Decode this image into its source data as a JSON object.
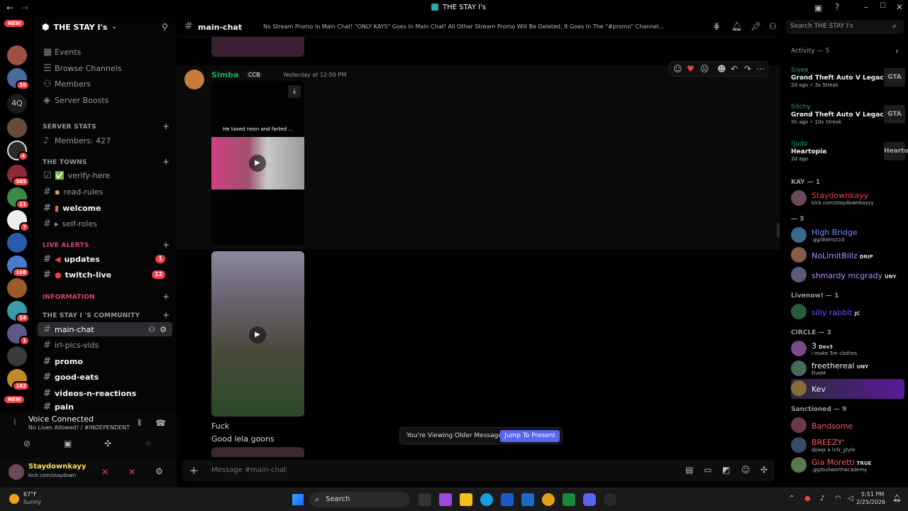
{
  "window": {
    "title": "THE STAY I's"
  },
  "server": {
    "name": "THE STAY I's"
  },
  "server_list": {
    "new_top": "NEW",
    "new_bottom": "NEW",
    "badge_4q": "4Q",
    "badges": [
      "36",
      "4",
      "365",
      "21",
      "7",
      "108",
      "14",
      "1",
      "162"
    ]
  },
  "sidebar": {
    "nav": [
      "Events",
      "Browse Channels",
      "Members",
      "Server Boosts"
    ],
    "cat_server_stats": "SERVER STATS",
    "members_count": "Members: 427",
    "cat_towns": "THE TOWNS",
    "towns": [
      "verify-here",
      "read-rules",
      "welcome",
      "self-roles"
    ],
    "cat_live": "LIVE ALERTS",
    "live": [
      "updates",
      "twitch-live"
    ],
    "live_unread": [
      "1",
      "12"
    ],
    "cat_info": "INFORMATION",
    "cat_community": "THE STAY I 'S COMMUNITY",
    "community": [
      "main-chat",
      "irl-pics-vids",
      "promo",
      "good-eats",
      "videos-n-reactions",
      "pain"
    ]
  },
  "voice": {
    "title": "Voice Connected",
    "subtitle": "No Lives Allowed! / #INDEPENDENT"
  },
  "user": {
    "name": "Staydownkayy",
    "status": "kick.com/staydown"
  },
  "chat_header": {
    "channel": "main-chat",
    "topic": "No Stream Promo In Main Chat! \"ONLY KAYS\" Goes In Main Chat! All Other Stream Promo Will Be Deleted, It Goes In The \"#promo\" Channel..."
  },
  "search": {
    "placeholder": "Search THE STAY I's"
  },
  "message": {
    "author": "Simba",
    "badge": "CCB",
    "time": "Yesterday at 12:50 PM",
    "video_caption": "He taxed neon and farted ...",
    "line1": "Fuck",
    "line2": "Good lela goons"
  },
  "older_banner": {
    "text": "You're Viewing Older Messages",
    "button": "Jump To Present"
  },
  "composer": {
    "placeholder": "Message #main-chat"
  },
  "members_panel": {
    "activity_header": "Activity — 5",
    "activities": [
      {
        "name": "Sivee",
        "game": "Grand Theft Auto V Legacy",
        "meta": "2d ago  ⚡ 3x Streak",
        "logo": "GTA"
      },
      {
        "name": "Sitchy",
        "game": "Grand Theft Auto V Legacy",
        "meta": "5h ago  ⚡ 10x Streak",
        "logo": "GTA"
      },
      {
        "name": "!Judo",
        "game": "Heartopia",
        "meta": "2d ago",
        "logo": "Heartopia"
      }
    ],
    "groups": [
      {
        "title": "KAY — 1",
        "members": [
          {
            "name": "Staydownkayy",
            "status": "kick.com/staydownkayyy",
            "color": "#f23f43",
            "tag": ""
          }
        ]
      },
      {
        "title": "— 3",
        "members": [
          {
            "name": "High Bridge",
            "status": ".gg/district10",
            "color": "#7b8cff",
            "tag": ""
          },
          {
            "name": "NoLimitBillz",
            "status": "",
            "color": "#b88cff",
            "tag": "DRIP"
          },
          {
            "name": "shmardy mcgrady",
            "status": "",
            "color": "#b88cff",
            "tag": "UNY"
          }
        ]
      },
      {
        "title": "Livenow! — 1",
        "members": [
          {
            "name": "silly rabbit",
            "status": "",
            "color": "#6b4cff",
            "tag": "JC"
          }
        ]
      },
      {
        "title": "CIRCLE — 3",
        "members": [
          {
            "name": "3",
            "status": "i make 5m clothes",
            "color": "#f2f3f5",
            "tag": "Dev3"
          },
          {
            "name": "freethereal",
            "status": "FiveM",
            "color": "#f2f3f5",
            "tag": "UNY"
          },
          {
            "name": "Kev",
            "status": "",
            "color": "#f2f3f5",
            "tag": ""
          }
        ]
      },
      {
        "title": "Sanctioned — 9",
        "members": [
          {
            "name": "Bandsome",
            "status": "",
            "color": "#f0605a",
            "tag": ""
          },
          {
            "name": "BREEZY'",
            "status": "ɖօʍլε ʀ lʏfɛ_ʂtyle",
            "color": "#f0605a",
            "tag": ""
          },
          {
            "name": "Gia Moretti",
            "status": ".gg/bullworthacademy",
            "color": "#f0605a",
            "tag": "TRUE"
          }
        ]
      }
    ]
  },
  "taskbar": {
    "weather_temp": "67°F",
    "weather_desc": "Sunny",
    "search": "Search",
    "time": "5:51 PM",
    "date": "2/25/2026"
  },
  "colors": {
    "accent": "#5865f2",
    "online": "#23a55a",
    "danger": "#f23f43"
  }
}
